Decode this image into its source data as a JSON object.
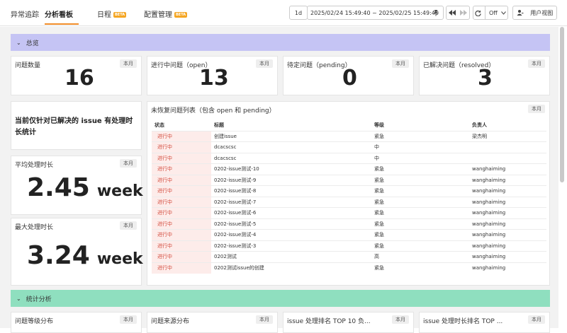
{
  "nav": {
    "tabs": [
      {
        "label": "异常追踪"
      },
      {
        "label": "分析看板"
      },
      {
        "label": "日程",
        "badge": "BETA"
      },
      {
        "label": "配置管理",
        "badge": "BETA"
      }
    ]
  },
  "toolbar": {
    "range_short": "1d",
    "time_range": "2025/02/24 15:49:40 ~ 2025/02/25 15:49:40",
    "refresh_label": "Off",
    "user_view": "用户视图",
    "pin_icon": "pin-icon",
    "rewind_icon": "rewind-icon",
    "forward_icon": "forward-icon",
    "refresh_icon": "refresh-icon",
    "chevron_icon": "chevron-down-icon",
    "user_icon": "user-view-icon"
  },
  "sections": {
    "overview": {
      "label": "总览",
      "color": "#c5c4f4"
    },
    "stats": {
      "label": "统计分析",
      "color": "#8fdfbf"
    }
  },
  "stats": [
    {
      "title": "问题数量",
      "badge": "本月",
      "value": "16"
    },
    {
      "title": "进行中问题（open）",
      "badge": "本月",
      "value": "13"
    },
    {
      "title": "待定问题（pending）",
      "badge": "本月",
      "value": "0"
    },
    {
      "title": "已解决问题（resolved）",
      "badge": "本月",
      "value": "3"
    }
  ],
  "note": "当前仅针对已解决的 issue 有处理时长统计",
  "duration": {
    "avg": {
      "title": "平均处理时长",
      "badge": "本月",
      "value": "2.45",
      "unit": "week"
    },
    "max": {
      "title": "最大处理时长",
      "badge": "本月",
      "value": "3.24",
      "unit": "week"
    }
  },
  "issue_table": {
    "title": "未恢复问题列表（包含 open 和 pending）",
    "badge": "本月",
    "columns": [
      "状态",
      "标题",
      "等级",
      "负责人"
    ],
    "rows": [
      [
        "进行中",
        "创建issue",
        "紧急",
        "梁杰明"
      ],
      [
        "进行中",
        "dcacscsc",
        "中",
        ""
      ],
      [
        "进行中",
        "dcacscsc",
        "中",
        ""
      ],
      [
        "进行中",
        "0202-issue测试-10",
        "紧急",
        "wanghaiming"
      ],
      [
        "进行中",
        "0202-issue测试-9",
        "紧急",
        "wanghaiming"
      ],
      [
        "进行中",
        "0202-issue测试-8",
        "紧急",
        "wanghaiming"
      ],
      [
        "进行中",
        "0202-issue测试-7",
        "紧急",
        "wanghaiming"
      ],
      [
        "进行中",
        "0202-issue测试-6",
        "紧急",
        "wanghaiming"
      ],
      [
        "进行中",
        "0202-issue测试-5",
        "紧急",
        "wanghaiming"
      ],
      [
        "进行中",
        "0202-issue测试-4",
        "紧急",
        "wanghaiming"
      ],
      [
        "进行中",
        "0202-issue测试-3",
        "紧急",
        "wanghaiming"
      ],
      [
        "进行中",
        "0202测试",
        "高",
        "wanghaiming"
      ],
      [
        "进行中",
        "0202测试issue的创建",
        "紧急",
        "wanghaiming"
      ]
    ]
  },
  "bottom_cards": [
    {
      "title": "问题等级分布",
      "badge": "本月"
    },
    {
      "title": "问题来源分布",
      "badge": "本月"
    },
    {
      "title": "issue 处理排名 TOP 10 负...",
      "badge": "本月"
    },
    {
      "title": "issue 处理时长排名 TOP ...",
      "badge": "本月"
    }
  ]
}
